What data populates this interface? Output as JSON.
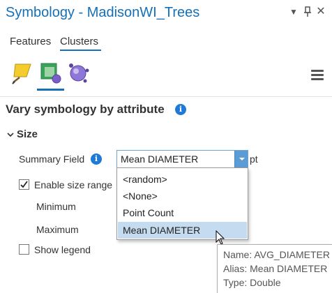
{
  "window": {
    "title": "Symbology - MadisonWI_Trees",
    "buttons": {
      "options_icon": "chevron-down-icon",
      "pin_icon": "pin-icon",
      "close_icon": "close-icon"
    }
  },
  "tabs": [
    {
      "label": "Features",
      "active": false
    },
    {
      "label": "Clusters",
      "active": true
    }
  ],
  "mode_icons": [
    {
      "name": "edit-symbol-icon",
      "active": false
    },
    {
      "name": "vary-symbology-icon",
      "active": true
    },
    {
      "name": "cluster-label-icon",
      "active": false
    }
  ],
  "menu_icon": "hamburger-menu-icon",
  "heading": {
    "text": "Vary symbology by attribute",
    "info_icon": "i"
  },
  "section": {
    "label": "Size",
    "expanded": true
  },
  "summary_field": {
    "label": "Summary Field",
    "info_icon": "i",
    "value": "Mean DIAMETER",
    "unit": "pt"
  },
  "enable_size_range": {
    "label": "Enable size range",
    "checked": true
  },
  "minimum": {
    "label": "Minimum"
  },
  "maximum": {
    "label": "Maximum"
  },
  "show_legend": {
    "label": "Show legend",
    "checked": false
  },
  "dropdown": {
    "options": [
      "<random>",
      "<None>",
      "Point Count",
      "Mean DIAMETER"
    ],
    "selected_index": 3
  },
  "tooltip": {
    "name": "Name: AVG_DIAMETER",
    "alias": "Alias: Mean DIAMETER",
    "type": "Type: Double"
  },
  "colors": {
    "accent": "#1570b8",
    "combo_button": "#5d9bd5",
    "selected_row": "#c5dcf0",
    "info_icon": "#1e7ad6"
  }
}
